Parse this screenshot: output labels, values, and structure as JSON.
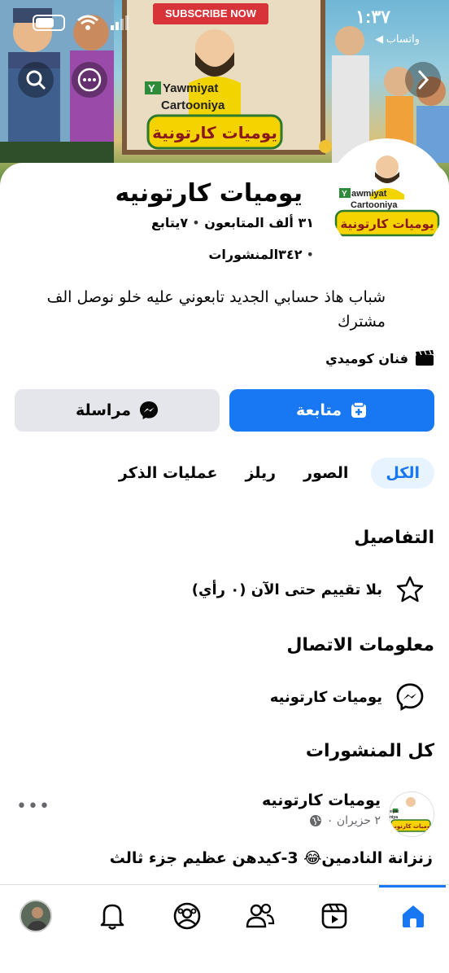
{
  "status_bar": {
    "time": "١:٣٧",
    "back_app": "◀ واتساب"
  },
  "cover": {
    "banner_text": "SUBSCRIBE NOW",
    "logo_line1": "Yawmiyat",
    "logo_line2": "Cartooniya",
    "logo_arabic": "يوميات كارتونية"
  },
  "profile": {
    "name": "يوميات كارتونيه",
    "followers": "٣١ ألف المتابعون",
    "following": "٧يتابع",
    "posts": "٣٤٢المنشورات",
    "bio": "شباب هاذ حسابي الجديد تابعوني عليه خلو نوصل الف مشترك",
    "category": "فنان كوميدي"
  },
  "actions": {
    "follow": "متابعة",
    "message": "مراسلة"
  },
  "tabs": [
    {
      "label": "الكل",
      "active": true
    },
    {
      "label": "الصور",
      "active": false
    },
    {
      "label": "ريلز",
      "active": false
    },
    {
      "label": "عمليات الذكر",
      "active": false
    }
  ],
  "details": {
    "title": "التفاصيل",
    "rating": "بلا تقييم حتى الآن (٠ رأي)"
  },
  "contact": {
    "title": "معلومات الاتصال",
    "messenger": "يوميات كارتونيه"
  },
  "all_posts": {
    "title": "كل المنشورات",
    "post": {
      "author": "يوميات كارتونيه",
      "date": "٢ حزيران ٠",
      "text": "زنزانة النادمين😂 3-كيدهن عظيم   جزء ثالث"
    }
  },
  "colors": {
    "accent": "#1877f2",
    "secondary_button": "#e4e6eb",
    "muted_text": "#65676b"
  },
  "nav_icons": [
    "home-icon",
    "reels-icon",
    "friends-icon",
    "profile-circle-icon",
    "bell-icon",
    "avatar"
  ]
}
